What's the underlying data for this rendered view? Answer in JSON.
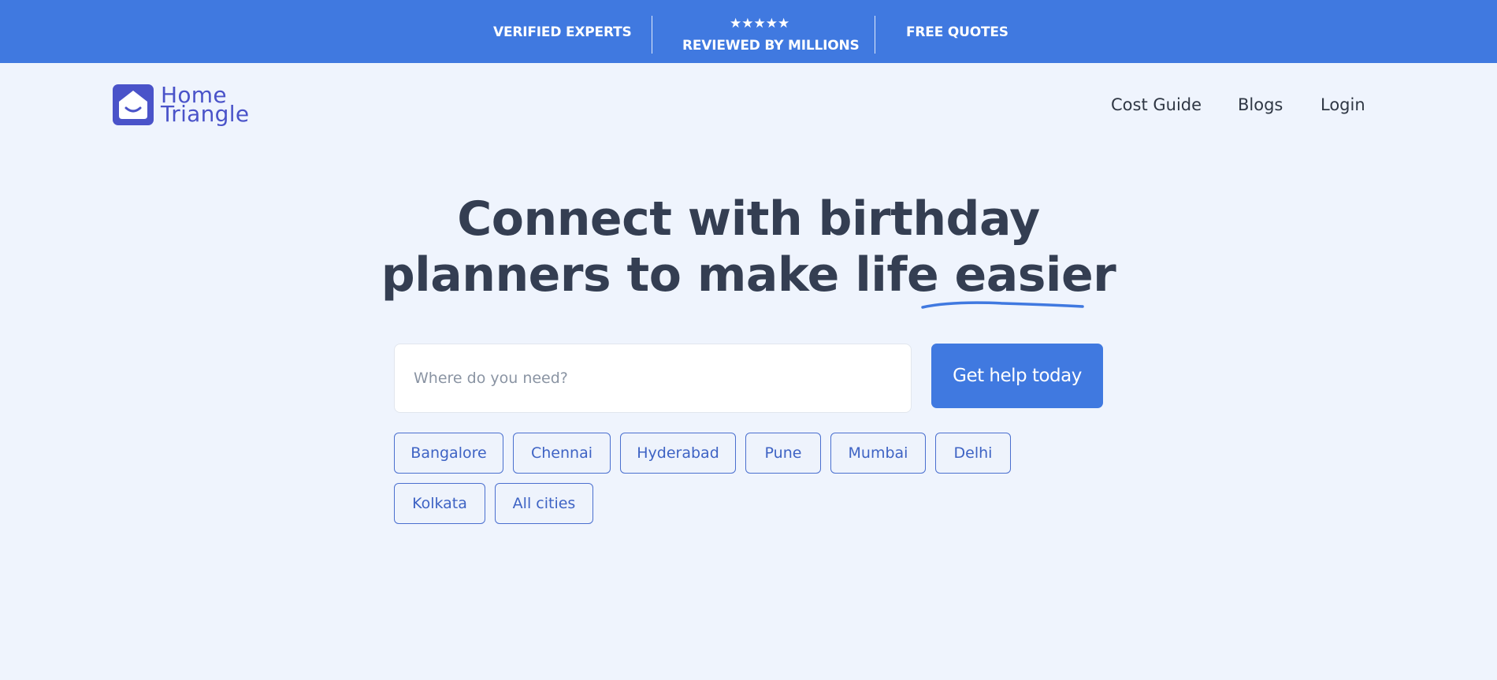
{
  "topbar": {
    "verified": "VERIFIED EXPERTS",
    "stars": "★★★★★",
    "reviewed": "REVIEWED BY MILLIONS",
    "quotes": "FREE QUOTES"
  },
  "logo": {
    "line1": "Home",
    "line2": "Triangle"
  },
  "nav": {
    "cost_guide": "Cost Guide",
    "blogs": "Blogs",
    "login": "Login"
  },
  "hero": {
    "line1": "Connect with birthday",
    "line2": "planners to make life easier"
  },
  "search": {
    "placeholder": "Where do you need?",
    "value": ""
  },
  "cta": {
    "label": "Get help today"
  },
  "cities": [
    "Bangalore",
    "Chennai",
    "Hyderabad",
    "Pune",
    "Mumbai",
    "Delhi",
    "Kolkata",
    "All cities"
  ],
  "colors": {
    "brand_blue": "#4079e0",
    "logo_indigo": "#4a53c9",
    "background": "#eff4fd",
    "text_dark": "#343e52"
  },
  "icons": {
    "logo": "house-smile-icon",
    "underline": "squiggle-underline"
  }
}
